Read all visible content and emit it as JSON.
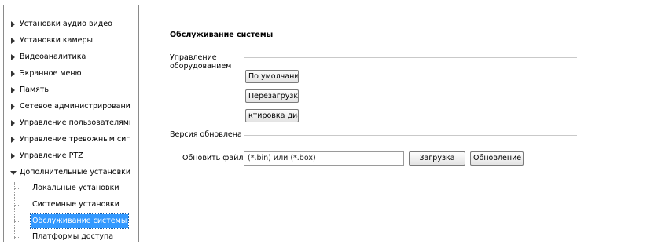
{
  "sidebar": {
    "items": [
      {
        "label": "Установки аудио видео"
      },
      {
        "label": "Установки камеры"
      },
      {
        "label": "Видеоаналитика"
      },
      {
        "label": "Экранное меню"
      },
      {
        "label": "Память"
      },
      {
        "label": "Сетевое администрирование"
      },
      {
        "label": "Управление пользователями"
      },
      {
        "label": "Управление тревожным сигналс"
      },
      {
        "label": "Управление PTZ"
      },
      {
        "label": "Дополнительные установки"
      }
    ],
    "subitems": [
      {
        "label": "Локальные установки"
      },
      {
        "label": "Системные установки"
      },
      {
        "label": "Обслуживание системы"
      },
      {
        "label": "Платформы доступа"
      }
    ]
  },
  "main": {
    "title": "Обслуживание системы",
    "hardware_label": "Управление оборудованием",
    "buttons": {
      "default": "По умолчанию",
      "reboot": "Перезагрузка",
      "diagnostics": "ктировка диафр"
    },
    "version_label": "Версия обновлена",
    "update_label": "Обновить файл",
    "file_input_value": "(*.bin) или (*.box)",
    "load_button": "Загрузка",
    "update_button": "Обновление"
  }
}
